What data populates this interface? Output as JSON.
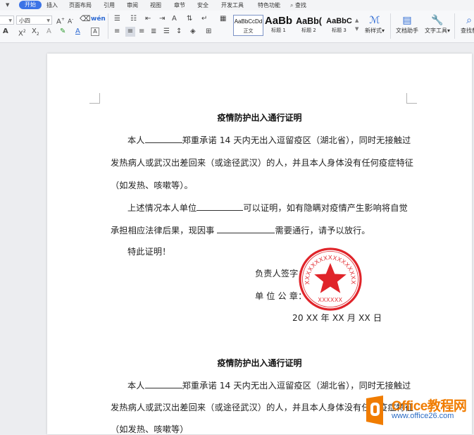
{
  "menu": {
    "tabs": [
      "开始",
      "插入",
      "页面布局",
      "引用",
      "审阅",
      "视图",
      "章节",
      "安全",
      "开发工具",
      "特色功能"
    ],
    "active_tab": "开始",
    "search_label": "查找",
    "accent": "#3b73e6"
  },
  "ribbon": {
    "font_size_value": "小四",
    "styles": [
      {
        "preview": "AaBbCcDd",
        "name": "正文"
      },
      {
        "preview": "AaBb",
        "name": "标题 1"
      },
      {
        "preview": "AaBb(",
        "name": "标题 2"
      },
      {
        "preview": "AaBbC",
        "name": "标题 3"
      }
    ],
    "new_style_label": "新样式",
    "doc_helper_label": "文档助手",
    "text_tools_label": "文字工具",
    "find_replace_label": "查找替"
  },
  "document": {
    "title": "疫情防护出入通行证明",
    "p1_a": "本人",
    "p1_b": "郑重承诺 14 天内无出入逗留疫区（湖北省），同时无接触过",
    "p1_line2": "发热病人或武汉出差回来（或途径武汉）的人，并且本人身体没有任何疫症特征",
    "p1_line3": "（如发热、咳嗽等）。",
    "p2_a": "上述情况本人单位",
    "p2_b": "可以证明，如有隐瞒对疫情产生影响将自觉",
    "p2_line2_a": "承担相应法律后果，现因事",
    "p2_line2_b": "需要通行，请予以放行。",
    "closing": "特此证明！",
    "signer_label": "负责人签字：",
    "seal_label": "单 位 公 章：",
    "date": "20 XX 年  XX 月 XX 日",
    "title2": "疫情防护出入通行证明",
    "p3_line1_b": "郑重承诺 14 天内无出入逗留疫区（湖北省），同时无接触过",
    "p3_line2": "发热病人或武汉出差回来（或途径武汉）的人，并且本人身体没有任何疫症特征",
    "p3_line3": "（如发热、咳嗽等）"
  },
  "stamp": {
    "ring_text": "XXXXXXXXXXXXXXXXX",
    "bottom_text": "XXXXXX",
    "color": "#e0242a"
  },
  "watermark": {
    "name": "Office教程网",
    "url": "www.office26.com"
  }
}
